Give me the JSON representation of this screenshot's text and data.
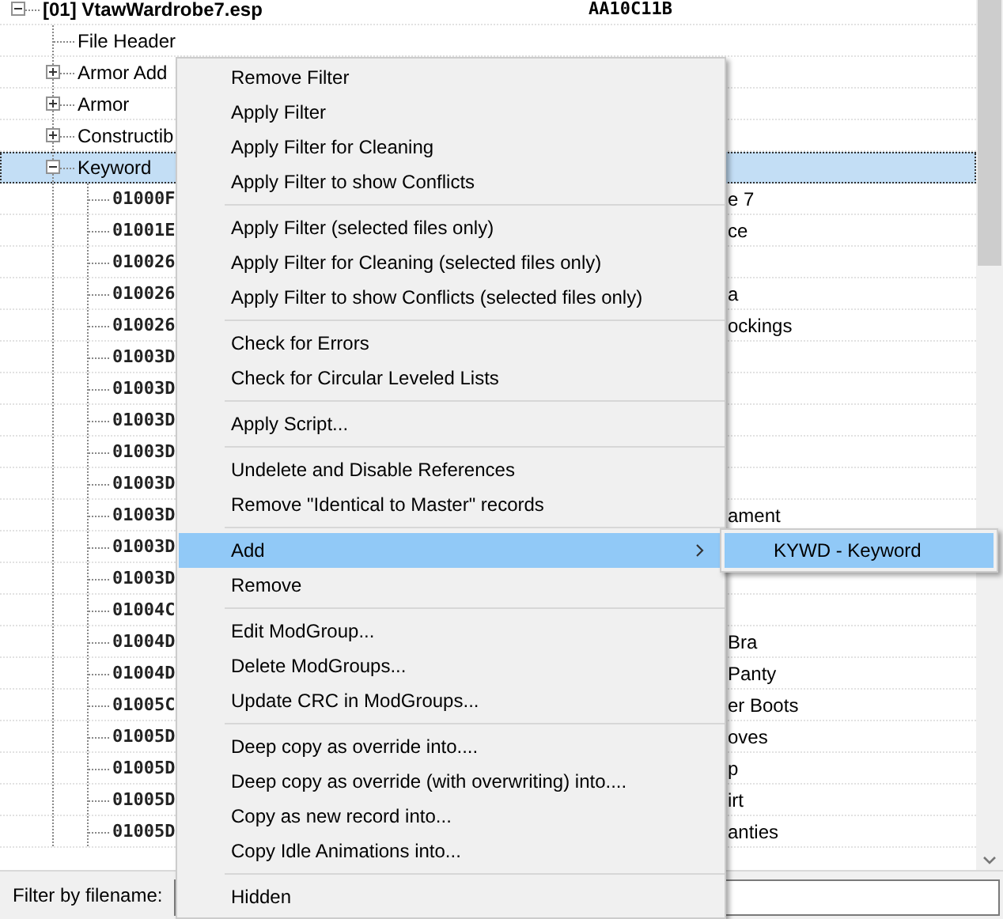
{
  "tree": {
    "nodes": [
      {
        "label": "[01] VtawWardrobe7.esp",
        "value": "AA10C11B",
        "expanded": true,
        "selected": false,
        "children": [
          {
            "label": "File Header",
            "selected": false
          },
          {
            "label": "Armor Add",
            "expanded": false,
            "selected": false
          },
          {
            "label": "Armor",
            "expanded": false,
            "selected": false
          },
          {
            "label": "Constructib",
            "expanded": false,
            "selected": false
          },
          {
            "label": "Keyword",
            "expanded": true,
            "selected": true,
            "children": [
              {
                "label": "01000F",
                "value": "e 7",
                "selected": false
              },
              {
                "label": "01001E",
                "value": "ce",
                "selected": false
              },
              {
                "label": "010026",
                "selected": false
              },
              {
                "label": "010026",
                "value": "a",
                "selected": false
              },
              {
                "label": "010026",
                "value": "ockings",
                "selected": false
              },
              {
                "label": "01003D",
                "selected": false
              },
              {
                "label": "01003D",
                "selected": false
              },
              {
                "label": "01003D",
                "selected": false
              },
              {
                "label": "01003D",
                "selected": false
              },
              {
                "label": "01003D",
                "selected": false
              },
              {
                "label": "01003D",
                "value": "ament",
                "selected": false
              },
              {
                "label": "01003D",
                "selected": false
              },
              {
                "label": "01003D",
                "selected": false
              },
              {
                "label": "01004C",
                "selected": false
              },
              {
                "label": "01004D",
                "value": "Bra",
                "selected": false
              },
              {
                "label": "01004D",
                "value": "Panty",
                "selected": false
              },
              {
                "label": "01005C",
                "value": "er Boots",
                "selected": false
              },
              {
                "label": "01005D",
                "value": "oves",
                "selected": false
              },
              {
                "label": "01005D",
                "value": "p",
                "selected": false
              },
              {
                "label": "01005D",
                "value": "irt",
                "selected": false
              },
              {
                "label": "01005D",
                "value": "anties",
                "selected": false
              }
            ]
          }
        ]
      }
    ]
  },
  "filter": {
    "label": "Filter by filename:"
  },
  "context_menu": {
    "items": [
      {
        "kind": "item",
        "label": "Remove Filter",
        "selected": false
      },
      {
        "kind": "item",
        "label": "Apply Filter",
        "selected": false
      },
      {
        "kind": "item",
        "label": "Apply Filter for Cleaning",
        "selected": false
      },
      {
        "kind": "item",
        "label": "Apply Filter to show Conflicts",
        "selected": false
      },
      {
        "kind": "separator"
      },
      {
        "kind": "item",
        "label": "Apply Filter (selected files only)",
        "selected": false
      },
      {
        "kind": "item",
        "label": "Apply Filter for Cleaning (selected files only)",
        "selected": false
      },
      {
        "kind": "item",
        "label": "Apply Filter to show Conflicts (selected files only)",
        "selected": false
      },
      {
        "kind": "separator"
      },
      {
        "kind": "item",
        "label": "Check for Errors",
        "selected": false
      },
      {
        "kind": "item",
        "label": "Check for Circular Leveled Lists",
        "selected": false
      },
      {
        "kind": "separator"
      },
      {
        "kind": "item",
        "label": "Apply Script...",
        "selected": false
      },
      {
        "kind": "separator"
      },
      {
        "kind": "item",
        "label": "Undelete and Disable References",
        "selected": false
      },
      {
        "kind": "item",
        "label": "Remove \"Identical to Master\" records",
        "selected": false
      },
      {
        "kind": "separator"
      },
      {
        "kind": "submenu",
        "label": "Add",
        "selected": true
      },
      {
        "kind": "item",
        "label": "Remove",
        "selected": false
      },
      {
        "kind": "separator"
      },
      {
        "kind": "item",
        "label": "Edit ModGroup...",
        "selected": false
      },
      {
        "kind": "item",
        "label": "Delete ModGroups...",
        "selected": false
      },
      {
        "kind": "item",
        "label": "Update CRC in ModGroups...",
        "selected": false
      },
      {
        "kind": "separator"
      },
      {
        "kind": "item",
        "label": "Deep copy as override into....",
        "selected": false
      },
      {
        "kind": "item",
        "label": "Deep copy as override (with overwriting) into....",
        "selected": false
      },
      {
        "kind": "item",
        "label": "Copy as new record into...",
        "selected": false
      },
      {
        "kind": "item",
        "label": "Copy Idle Animations into...",
        "selected": false
      },
      {
        "kind": "separator"
      },
      {
        "kind": "item",
        "label": "Hidden",
        "selected": false
      }
    ]
  },
  "submenu": {
    "items": [
      {
        "label": "KYWD - Keyword",
        "selected": true
      }
    ]
  }
}
